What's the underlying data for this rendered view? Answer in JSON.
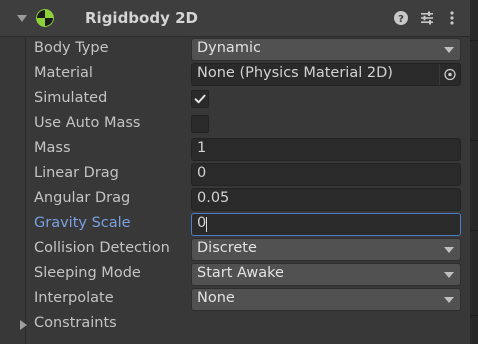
{
  "component": {
    "title": "Rigidbody 2D",
    "enabled": true,
    "icons": [
      "help-icon",
      "preset-icon",
      "more-menu-icon"
    ]
  },
  "fields": {
    "body_type": {
      "label": "Body Type",
      "value": "Dynamic"
    },
    "material": {
      "label": "Material",
      "value": "None (Physics Material 2D)"
    },
    "simulated": {
      "label": "Simulated",
      "checked": true
    },
    "use_auto_mass": {
      "label": "Use Auto Mass",
      "checked": false
    },
    "mass": {
      "label": "Mass",
      "value": "1"
    },
    "linear_drag": {
      "label": "Linear Drag",
      "value": "0"
    },
    "angular_drag": {
      "label": "Angular Drag",
      "value": "0.05"
    },
    "gravity_scale": {
      "label": "Gravity Scale",
      "value": "0"
    },
    "collision_detection": {
      "label": "Collision Detection",
      "value": "Discrete"
    },
    "sleeping_mode": {
      "label": "Sleeping Mode",
      "value": "Start Awake"
    },
    "interpolate": {
      "label": "Interpolate",
      "value": "None"
    },
    "constraints": {
      "label": "Constraints",
      "expanded": false
    }
  },
  "colors": {
    "background": "#383838",
    "field_background": "#2a2a2a",
    "dropdown_background": "#515151",
    "focus_accent": "#4a7ec8",
    "active_label": "#7ba0e0",
    "rigidbody_icon_green": "#7ed321"
  }
}
